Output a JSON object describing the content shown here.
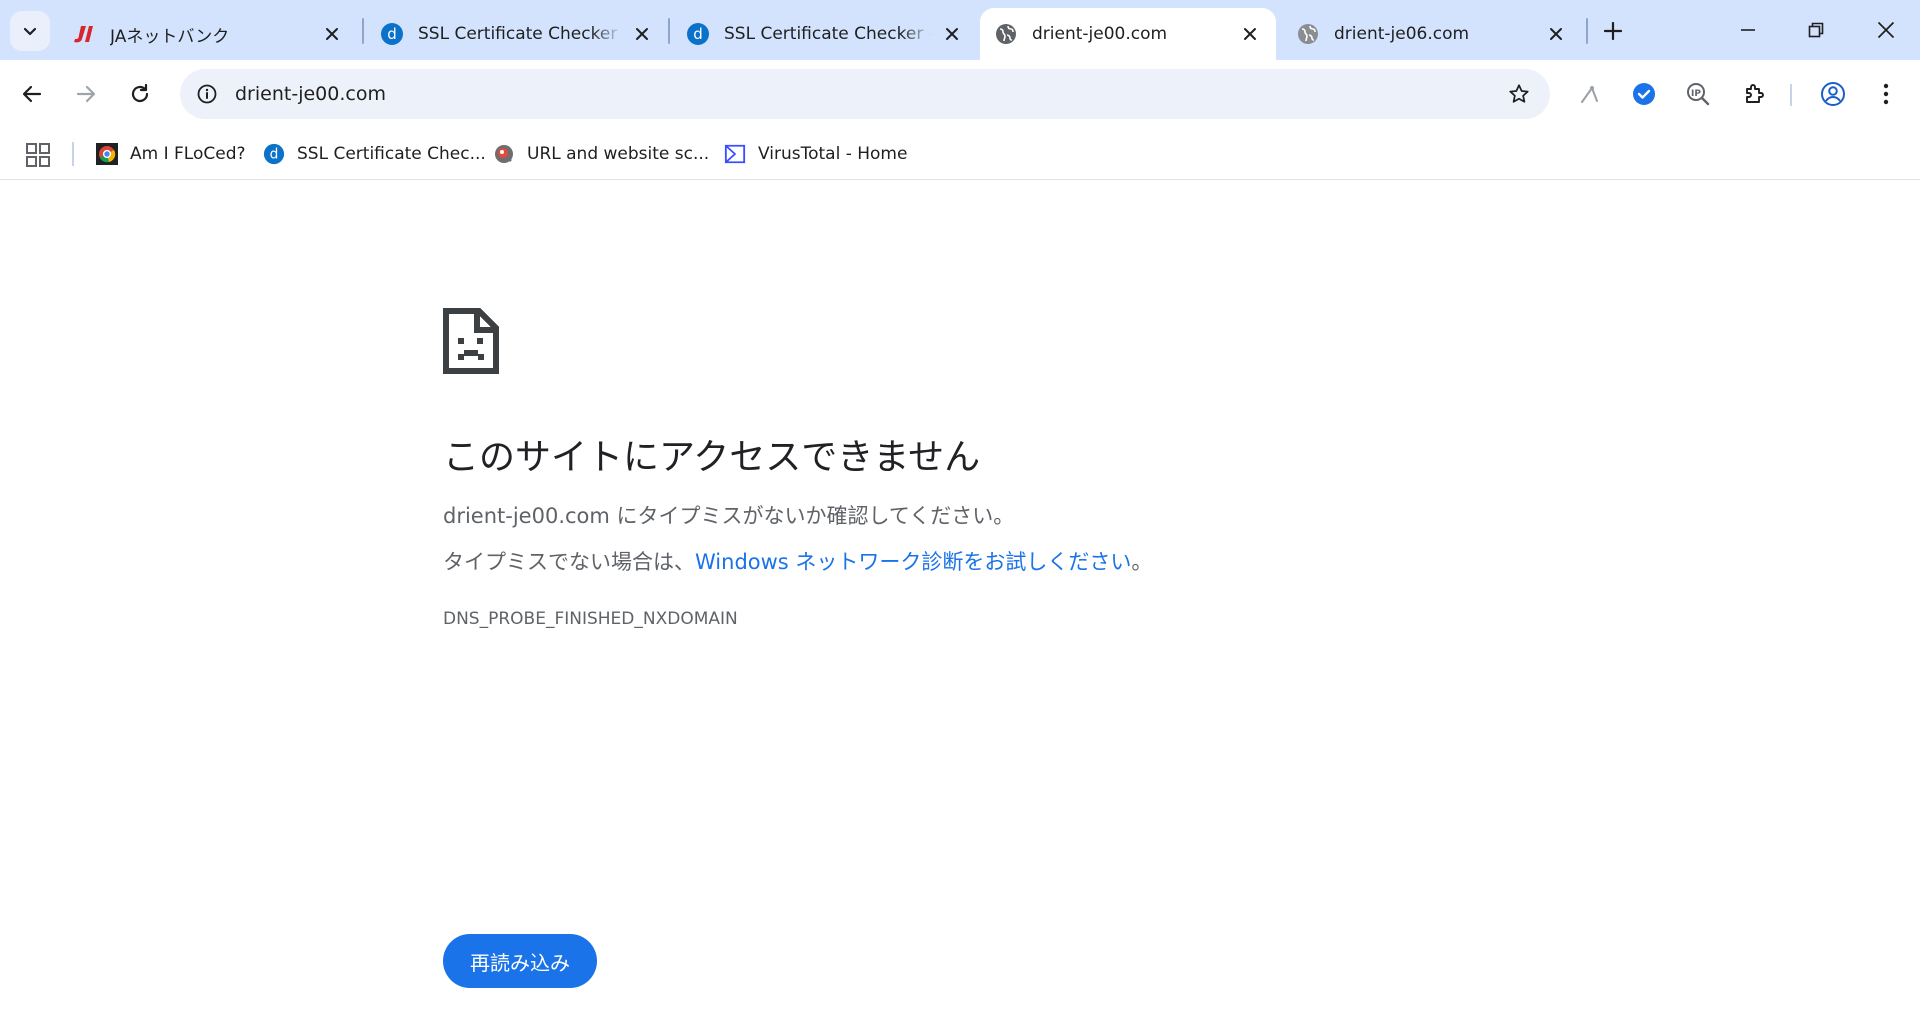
{
  "tabs": [
    {
      "title": "JAネットバンク",
      "favicon": "ja-logo-icon",
      "active": false
    },
    {
      "title": "SSL Certificate Checker -",
      "favicon": "d-circle-icon",
      "active": false
    },
    {
      "title": "SSL Certificate Checker -",
      "favicon": "d-circle-icon",
      "active": false
    },
    {
      "title": "drient-je00.com",
      "favicon": "globe-icon",
      "active": true
    },
    {
      "title": "drient-je06.com",
      "favicon": "globe-icon",
      "active": false
    }
  ],
  "omnibox": {
    "url": "drient-je00.com"
  },
  "bookmarks": [
    {
      "label": "Am I FLoCed?",
      "icon": "chrome-logo-icon"
    },
    {
      "label": "SSL Certificate Chec...",
      "icon": "d-circle-icon"
    },
    {
      "label": "URL and website sc...",
      "icon": "urlscan-icon"
    },
    {
      "label": "VirusTotal - Home",
      "icon": "virustotal-icon"
    }
  ],
  "error": {
    "heading": "このサイトにアクセスできません",
    "line1": "drient-je00.com にタイプミスがないか確認してください。",
    "line2_prefix": "タイプミスでない場合は、",
    "line2_link": "Windows ネットワーク診断をお試しください",
    "line2_suffix": "。",
    "code": "DNS_PROBE_FINISHED_NXDOMAIN",
    "reload_label": "再読み込み"
  },
  "colors": {
    "tabstrip": "#d3e3fd",
    "accent": "#1a73e8",
    "omnibox": "#edf2fa",
    "ja_brand": "#d7262e",
    "d_brand": "#0b72c9"
  }
}
